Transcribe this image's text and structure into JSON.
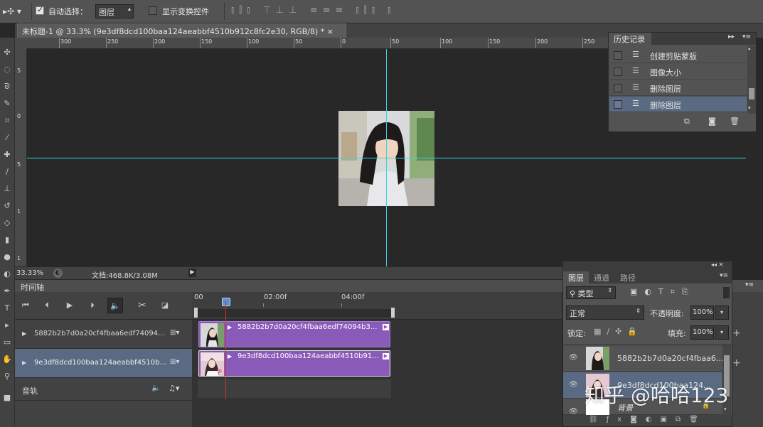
{
  "options_bar": {
    "auto_select_label": "自动选择：",
    "auto_select_value": "图层",
    "show_transform_label": "显示变换控件"
  },
  "document_tab": {
    "title": "未标题-1 @ 33.3% (9e3df8dcd100baa124aeabbf4510b912c8fc2e30, RGB/8) *",
    "close": "×"
  },
  "ruler": {
    "h_ticks": [
      "300",
      "250",
      "200",
      "150",
      "100",
      "50",
      "0",
      "50",
      "100",
      "150",
      "200",
      "250"
    ],
    "v_ticks": [
      "5",
      "0",
      "5",
      "1",
      "1"
    ]
  },
  "status": {
    "zoom": "33.33%",
    "doc_size": "文档:468.8K/3.08M"
  },
  "timeline": {
    "title": "时间轴",
    "marks": [
      "00",
      "02:00f",
      "04:00f"
    ],
    "tracks": [
      {
        "name": "5882b2b7d0a20cf4fbaa6edf74094...",
        "clip": "5882b2b7d0a20cf4fbaa6edf74094b3..."
      },
      {
        "name": "9e3df8dcd100baa124aeabbf4510b...",
        "clip": "9e3df8dcd100baa124aeabbf4510b91..."
      }
    ],
    "audio_label": "音轨"
  },
  "history": {
    "title": "历史记录",
    "items": [
      "创建剪贴蒙版",
      "图像大小",
      "删除图层",
      "删除图层"
    ]
  },
  "layers": {
    "tabs": [
      "图层",
      "通道",
      "路径"
    ],
    "filter_kind": "类型",
    "blend_mode": "正常",
    "opacity_label": "不透明度:",
    "opacity_value": "100%",
    "lock_label": "锁定:",
    "fill_label": "填充:",
    "fill_value": "100%",
    "items": [
      {
        "name": "5882b2b7d0a20cf4fbaa6..."
      },
      {
        "name": "9e3df8dcd100baa124..."
      },
      {
        "name": "背景"
      }
    ]
  },
  "watermark": "知乎 @哈哈123",
  "colors": {
    "clip": "#8a5ab8",
    "guide": "#36d4e0",
    "playhead": "#c0392b",
    "selection": "#5a6a82"
  }
}
